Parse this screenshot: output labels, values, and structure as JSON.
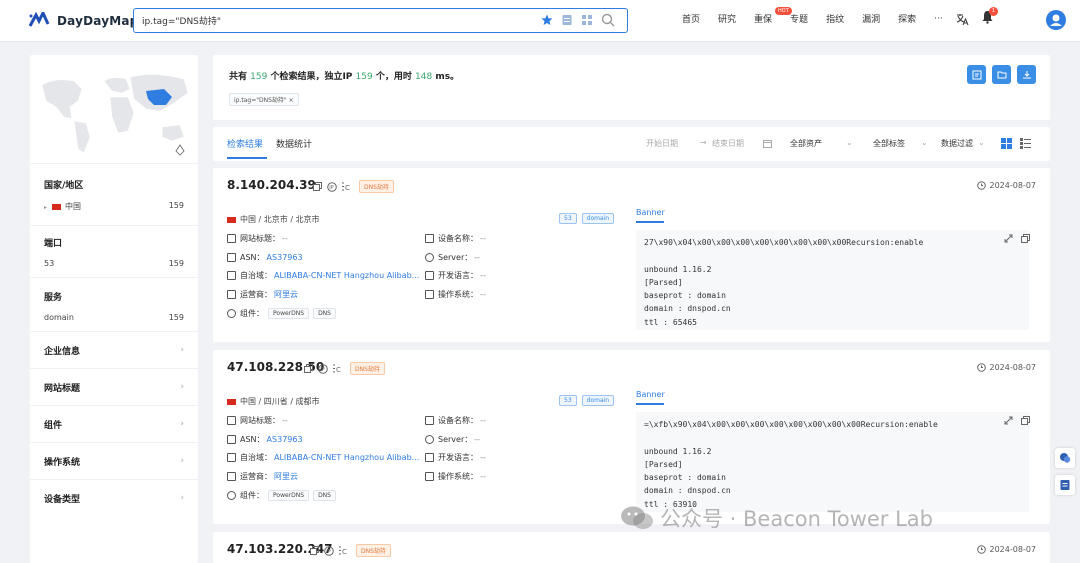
{
  "header": {
    "logo_text": "DayDayMap",
    "search_value": "ip.tag=\"DNS劫持\"",
    "nav": [
      "首页",
      "研究",
      "重保",
      "专题",
      "指纹",
      "漏洞",
      "探索",
      "···"
    ],
    "hot_badge": "HOT",
    "notif_count": "1"
  },
  "sidebar": {
    "country": {
      "title": "国家/地区",
      "label": "中国",
      "count": "159"
    },
    "port": {
      "title": "端口",
      "label": "53",
      "count": "159"
    },
    "service": {
      "title": "服务",
      "label": "domain",
      "count": "159"
    },
    "sections": [
      "企业信息",
      "网站标题",
      "组件",
      "操作系统",
      "设备类型"
    ]
  },
  "summary": {
    "p1": "共有 ",
    "total": "159",
    "p2": " 个检索结果，独立IP ",
    "unique_ip": "159",
    "p3": " 个，用时 ",
    "ms": "148",
    "p4": " ms。",
    "tag": "ip.tag=\"DNS劫持\" ×"
  },
  "tabs": {
    "results": "检索结果",
    "stats": "数据统计",
    "start_date": "开始日期",
    "arrow": "→",
    "end_date": "结束日期",
    "assets": "全部资产",
    "tags": "全部标签",
    "filter": "数据过滤"
  },
  "labels": {
    "title": "网站标题：",
    "device": "设备名称：",
    "asn": "ASN：",
    "server": "Server：",
    "as": "自治域：",
    "lang": "开发语言：",
    "isp": "运营商：",
    "os": "操作系统：",
    "comp": "组件：",
    "banner": "Banner",
    "dash": "--"
  },
  "results": [
    {
      "ip": "8.140.204.39",
      "tag": "DNS劫持",
      "date": "2024-08-07",
      "location": "中国 / 北京市 / 北京市",
      "ports": [
        "53",
        "domain"
      ],
      "asn": "AS37963",
      "as_name": "ALIBABA-CN-NET Hangzhou Alibab...",
      "isp": "阿里云",
      "components": [
        "PowerDNS",
        "DNS"
      ],
      "banner": "27\\x90\\x04\\x00\\x00\\x00\\x00\\x00\\x00\\x00\\x00Recursion:enable\n\nunbound 1.16.2\n[Parsed]\nbaseprot : domain\ndomain : dnspod.cn\nttl : 65465"
    },
    {
      "ip": "47.108.228.50",
      "tag": "DNS劫持",
      "date": "2024-08-07",
      "location": "中国 / 四川省 / 成都市",
      "ports": [
        "53",
        "domain"
      ],
      "asn": "AS37963",
      "as_name": "ALIBABA-CN-NET Hangzhou Alibab...",
      "isp": "阿里云",
      "components": [
        "PowerDNS",
        "DNS"
      ],
      "banner": "=\\xfb\\x90\\x04\\x00\\x00\\x00\\x00\\x00\\x00\\x00\\x00Recursion:enable\n\nunbound 1.16.2\n[Parsed]\nbaseprot : domain\ndomain : dnspod.cn\nttl : 63910"
    },
    {
      "ip": "47.103.220.247",
      "tag": "DNS劫持",
      "date": "2024-08-07"
    }
  ],
  "watermark": "公众号 · Beacon Tower Lab",
  "colors": {
    "accent": "#2f7de1",
    "count_green": "#3aa76d",
    "tag_orange": "#e8773a"
  }
}
